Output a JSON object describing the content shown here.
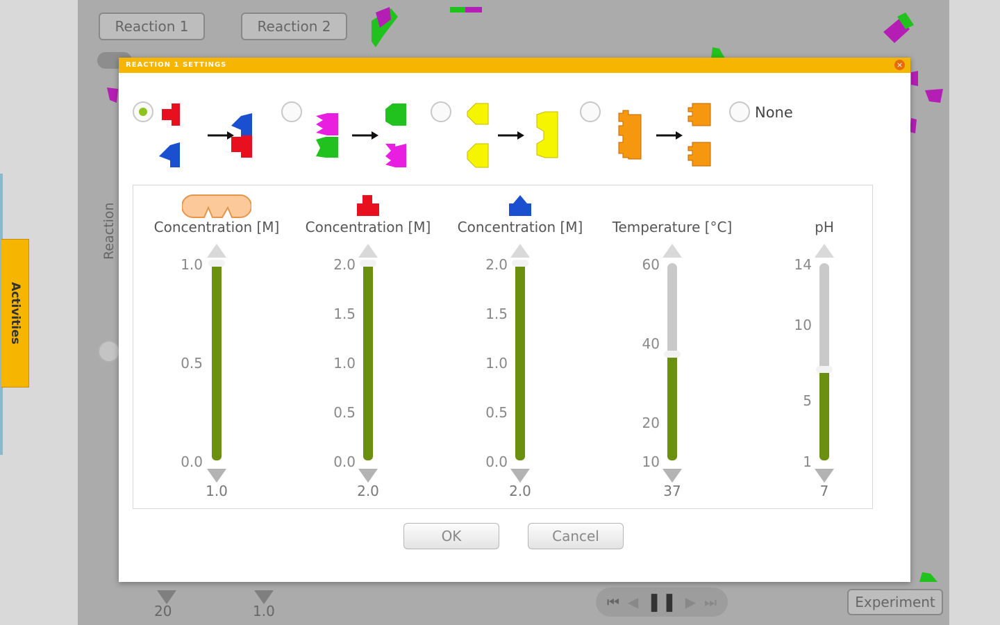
{
  "background": {
    "tabs": [
      "Reaction 1",
      "Reaction 2"
    ],
    "rate_axis_label": "Reaction Rate",
    "activities_label": "Activities",
    "bottom_values": [
      "20",
      "1.0"
    ],
    "experiment_label": "Experiment"
  },
  "dialog": {
    "title": "REACTION 1 SETTINGS",
    "none_label": "None",
    "ok_label": "OK",
    "cancel_label": "Cancel"
  },
  "sliders": [
    {
      "label": "Concentration [M]",
      "icon": "enzyme-icon",
      "ticks": [
        "1.0",
        "0.5",
        "0.0"
      ],
      "value": "1.0",
      "level": 1.0
    },
    {
      "label": "Concentration [M]",
      "icon": "red-substrate-icon",
      "ticks": [
        "2.0",
        "1.5",
        "1.0",
        "0.5",
        "0.0"
      ],
      "value": "2.0",
      "level": 1.0
    },
    {
      "label": "Concentration [M]",
      "icon": "blue-substrate-icon",
      "ticks": [
        "2.0",
        "1.5",
        "1.0",
        "0.5",
        "0.0"
      ],
      "value": "2.0",
      "level": 1.0
    },
    {
      "label": "Temperature [°C]",
      "ticks": [
        "60",
        "40",
        "20",
        "10"
      ],
      "value": "37",
      "level": 0.54
    },
    {
      "label": "pH",
      "ticks": [
        "14",
        "10",
        "5",
        "1"
      ],
      "value": "7",
      "level": 0.46
    }
  ],
  "colors": {
    "accent": "#f6b500",
    "fill": "#6b8f0e",
    "radio_selected": "#8cc31e"
  }
}
